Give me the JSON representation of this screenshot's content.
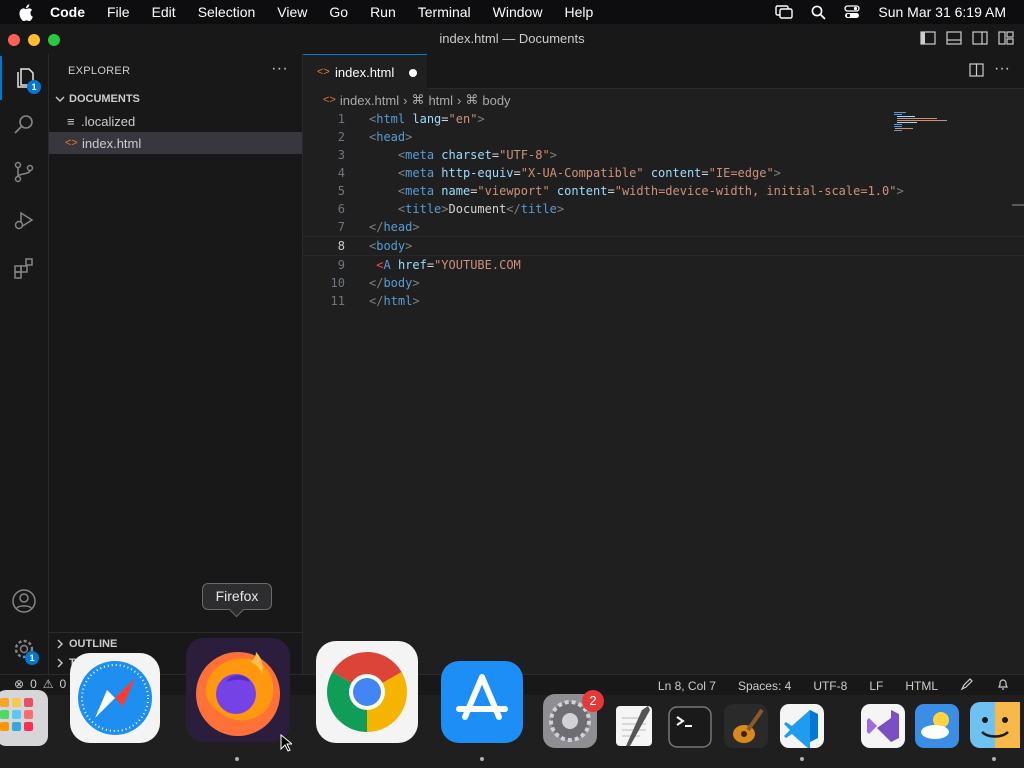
{
  "menubar": {
    "app_name": "Code",
    "items": [
      "File",
      "Edit",
      "Selection",
      "View",
      "Go",
      "Run",
      "Terminal",
      "Window",
      "Help"
    ],
    "clock": "Sun Mar 31  6:19 AM"
  },
  "window": {
    "title": "index.html — Documents"
  },
  "activity": {
    "explorer_badge": "1",
    "settings_badge": "1"
  },
  "sidebar": {
    "header": "EXPLORER",
    "more": "···",
    "section": "DOCUMENTS",
    "files": [
      ".localized",
      "index.html"
    ],
    "outline": "OUTLINE",
    "timeline_partial": "T"
  },
  "editor": {
    "tab_label": "index.html",
    "breadcrumb": [
      "index.html",
      "html",
      "body"
    ],
    "current_line": 8,
    "lines": [
      {
        "n": "1"
      },
      {
        "n": "2"
      },
      {
        "n": "3"
      },
      {
        "n": "4"
      },
      {
        "n": "5"
      },
      {
        "n": "6"
      },
      {
        "n": "7"
      },
      {
        "n": "8"
      },
      {
        "n": "9"
      },
      {
        "n": "10"
      },
      {
        "n": "11"
      }
    ],
    "code": {
      "l1_tag": "html",
      "l1_attr": "lang",
      "l1_val": "\"en\"",
      "l2_tag": "head",
      "l3_tag": "meta",
      "l3_attr": "charset",
      "l3_val": "\"UTF-8\"",
      "l4_tag": "meta",
      "l4_attr1": "http-equiv",
      "l4_val1": "\"X-UA-Compatible\"",
      "l4_attr2": "content",
      "l4_val2": "\"IE=edge\"",
      "l5_tag": "meta",
      "l5_attr1": "name",
      "l5_val1": "\"viewport\"",
      "l5_attr2": "content",
      "l5_val2": "\"width=device-width, initial-scale=1.0\"",
      "l6_tag": "title",
      "l6_text": "Document",
      "l7_tag": "head",
      "l8_tag": "body",
      "l9_tag": "A",
      "l9_attr": "href",
      "l9_val": "\"YOUTUBE.COM",
      "l10_tag": "body",
      "l11_tag": "html"
    }
  },
  "statusbar": {
    "errors": "0",
    "warnings": "0",
    "position": "Ln 8, Col 7",
    "spaces": "Spaces: 4",
    "encoding": "UTF-8",
    "eol": "LF",
    "language": "HTML"
  },
  "dock": {
    "tooltip": "Firefox",
    "settings_badge": "2",
    "apps": [
      "launchpad-icon",
      "safari-icon",
      "firefox-icon",
      "chrome-icon",
      "app-store-icon",
      "system-settings-icon",
      "textedit-icon",
      "terminal-icon",
      "garageband-icon",
      "vscode-icon",
      "visual-studio-icon",
      "weather-icon",
      "finder-icon"
    ]
  },
  "colors": {
    "accent": "#0078d4",
    "tag": "#569cd6",
    "attr": "#9cdcfe",
    "string": "#ce9178",
    "badge_red": "#e5383b"
  }
}
